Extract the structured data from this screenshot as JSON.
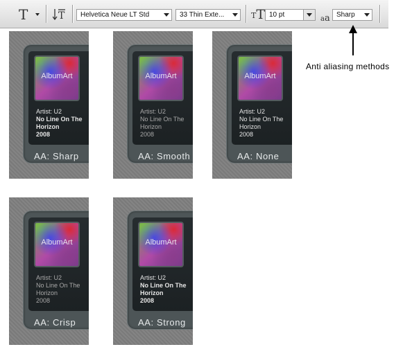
{
  "toolbar": {
    "font_family": "Helvetica Neue LT Std",
    "font_style": "33 Thin Exte...",
    "font_size": "10 pt",
    "aa_mode": "Sharp",
    "aa_icon_label": "a",
    "aa_icon_label_sub": "a"
  },
  "callout": "Anti aliasing methods",
  "cards": [
    {
      "album_label": "AlbumArt",
      "artist": "Artist: U2",
      "title_line1": "No Line On The",
      "title_line2": "Horizon",
      "year": "2008",
      "aa_label": "AA: Sharp"
    },
    {
      "album_label": "AlbumArt",
      "artist": "Artist: U2",
      "title_line1": "No Line On The",
      "title_line2": "Horizon",
      "year": "2008",
      "aa_label": "AA: Smooth"
    },
    {
      "album_label": "AlbumArt",
      "artist": "Artist: U2",
      "title_line1": "No Line On The",
      "title_line2": "Horizon",
      "year": "2008",
      "aa_label": "AA: None"
    },
    {
      "album_label": "AlbumArt",
      "artist": "Artist: U2",
      "title_line1": "No Line On The",
      "title_line2": "Horizon",
      "year": "2008",
      "aa_label": "AA: Crisp"
    },
    {
      "album_label": "AlbumArt",
      "artist": "Artist: U2",
      "title_line1": "No Line On The",
      "title_line2": "Horizon",
      "year": "2008",
      "aa_label": "AA: Strong"
    }
  ]
}
